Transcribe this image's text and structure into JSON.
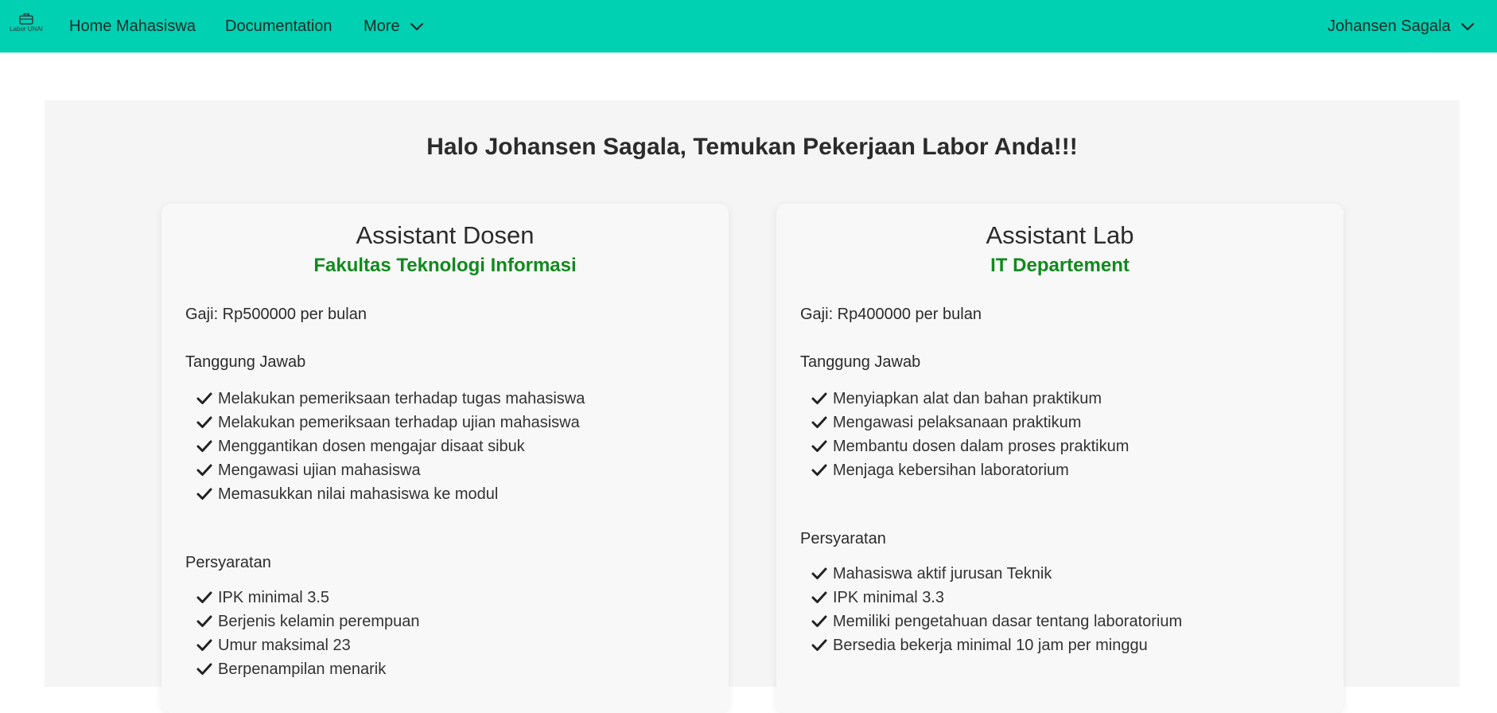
{
  "nav": {
    "logo_text": "Labor UNAI",
    "logo_icon": "briefcase-icon",
    "home": "Home Mahasiswa",
    "docs": "Documentation",
    "more": "More",
    "user": "Johansen Sagala"
  },
  "colors": {
    "navbar": "#00d1b2",
    "panel": "#f5f5f5",
    "subtitle_green": "#118a1e"
  },
  "headline": "Halo Johansen Sagala, Temukan Pekerjaan Labor Anda!!!",
  "cards": [
    {
      "title": "Assistant Dosen",
      "subtitle": "Fakultas Teknologi Informasi",
      "salary": "Gaji: Rp500000 per bulan",
      "duties_label": "Tanggung Jawab",
      "duties": [
        "Melakukan pemeriksaan terhadap tugas mahasiswa",
        "Melakukan pemeriksaan terhadap ujian mahasiswa",
        "Menggantikan dosen mengajar disaat sibuk",
        "Mengawasi ujian mahasiswa",
        "Memasukkan nilai mahasiswa ke modul"
      ],
      "req_label": "Persyaratan",
      "requirements": [
        "IPK minimal 3.5",
        "Berjenis kelamin perempuan",
        "Umur maksimal 23",
        "Berpenampilan menarik"
      ]
    },
    {
      "title": "Assistant Lab",
      "subtitle": "IT Departement",
      "salary": "Gaji: Rp400000 per bulan",
      "duties_label": "Tanggung Jawab",
      "duties": [
        "Menyiapkan alat dan bahan praktikum",
        "Mengawasi pelaksanaan praktikum",
        "Membantu dosen dalam proses praktikum",
        "Menjaga kebersihan laboratorium"
      ],
      "req_label": "Persyaratan",
      "requirements": [
        "Mahasiswa aktif jurusan Teknik",
        "IPK minimal 3.3",
        "Memiliki pengetahuan dasar tentang laboratorium",
        "Bersedia bekerja minimal 10 jam per minggu"
      ]
    }
  ]
}
